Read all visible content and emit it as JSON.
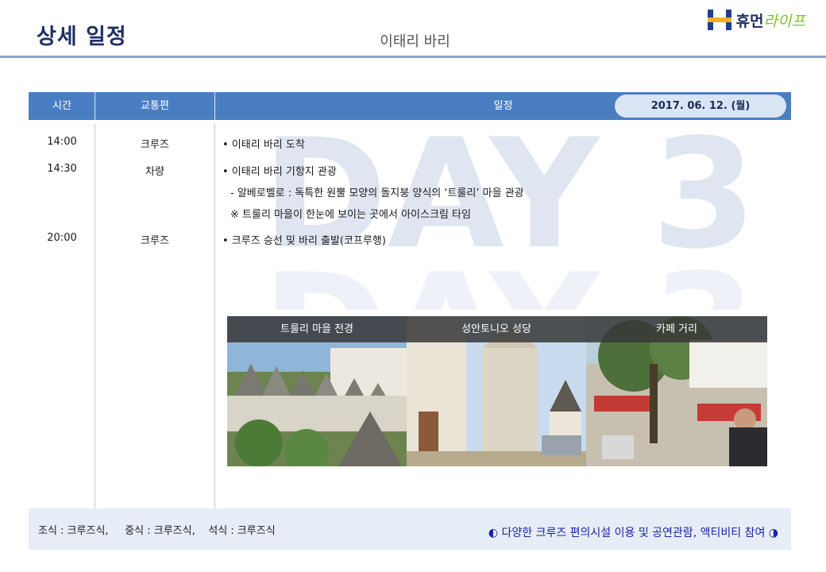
{
  "header": {
    "title": "상세 일정",
    "subtitle": "이태리 바리",
    "logo_text_a": "휴먼",
    "logo_text_b": "라이프"
  },
  "table": {
    "columns": [
      "시간",
      "교통편",
      "일정"
    ],
    "date": "2017. 06. 12. (월)",
    "rows": [
      {
        "time": "14:00",
        "transport": "크루즈",
        "schedule": "• 이태리 바리 도착"
      },
      {
        "time": "14:30",
        "transport": "차량",
        "schedule": "• 이태리 바리 기항지 관광"
      },
      {
        "time": "",
        "transport": "",
        "schedule": "- 알베로벨로 : 독특한 원뿔 모양의 돌지붕 양식의 ‘트룰리’ 마을 관광"
      },
      {
        "time": "",
        "transport": "",
        "schedule": "※ 트룰리 마을이 한눈에 보이는 곳에서 아이스크림 타임"
      },
      {
        "time": "20:00",
        "transport": "크루즈",
        "schedule": "• 크루즈 승선 및 바리 출발(코프루행)"
      }
    ]
  },
  "watermark": {
    "text_top": "DAY 3",
    "text_bottom": "DAY 3"
  },
  "photos": [
    {
      "caption": "트룰리 마을 전경",
      "icon": "trulli-village-photo"
    },
    {
      "caption": "성안토니오 성당",
      "icon": "church-photo"
    },
    {
      "caption": "카페 거리",
      "icon": "cafe-street-photo"
    }
  ],
  "footer": {
    "meals": "조식 : 크루즈식,     중식 : 크루즈식,    석식 : 크루즈식",
    "note": "◐ 다양한 크루즈 편의시설 이용 및 공연관람, 액티비티 참여 ◑"
  },
  "colors": {
    "header_bar": "#4a7ec2",
    "title": "#1f2f66",
    "footer_bg": "#e6edf7",
    "note_text": "#1a22a0",
    "logo_green": "#7cc52a"
  }
}
